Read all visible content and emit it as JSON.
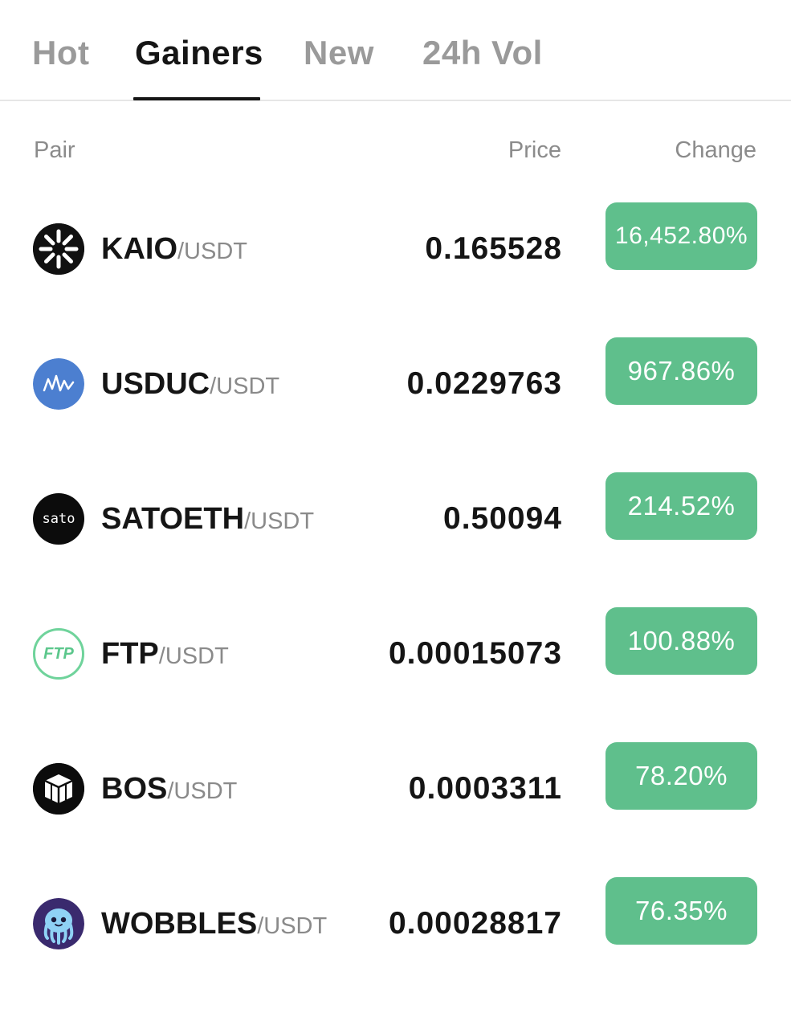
{
  "tabs": [
    {
      "label": "Hot",
      "active": false
    },
    {
      "label": "Gainers",
      "active": true
    },
    {
      "label": "New",
      "active": false
    },
    {
      "label": "24h Vol",
      "active": false
    }
  ],
  "columns": {
    "pair": "Pair",
    "price": "Price",
    "change": "Change"
  },
  "colors": {
    "gain_badge": "#5fbf8c",
    "active_tab": "#151515",
    "inactive_tab": "#9a9a9a"
  },
  "rows": [
    {
      "icon": "kaio-logo-icon",
      "base": "KAIO",
      "quote": "/USDT",
      "price": "0.165528",
      "change": "16,452.80%"
    },
    {
      "icon": "usduc-logo-icon",
      "base": "USDUC",
      "quote": "/USDT",
      "price": "0.0229763",
      "change": "967.86%"
    },
    {
      "icon": "sato-logo-icon",
      "icon_text": "sato",
      "base": "SATOETH",
      "quote": "/USDT",
      "price": "0.50094",
      "change": "214.52%"
    },
    {
      "icon": "ftp-logo-icon",
      "icon_text": "FTP",
      "base": "FTP",
      "quote": "/USDT",
      "price": "0.00015073",
      "change": "100.88%"
    },
    {
      "icon": "bos-logo-icon",
      "base": "BOS",
      "quote": "/USDT",
      "price": "0.0003311",
      "change": "78.20%"
    },
    {
      "icon": "wobbles-logo-icon",
      "base": "WOBBLES",
      "quote": "/USDT",
      "price": "0.00028817",
      "change": "76.35%"
    }
  ]
}
